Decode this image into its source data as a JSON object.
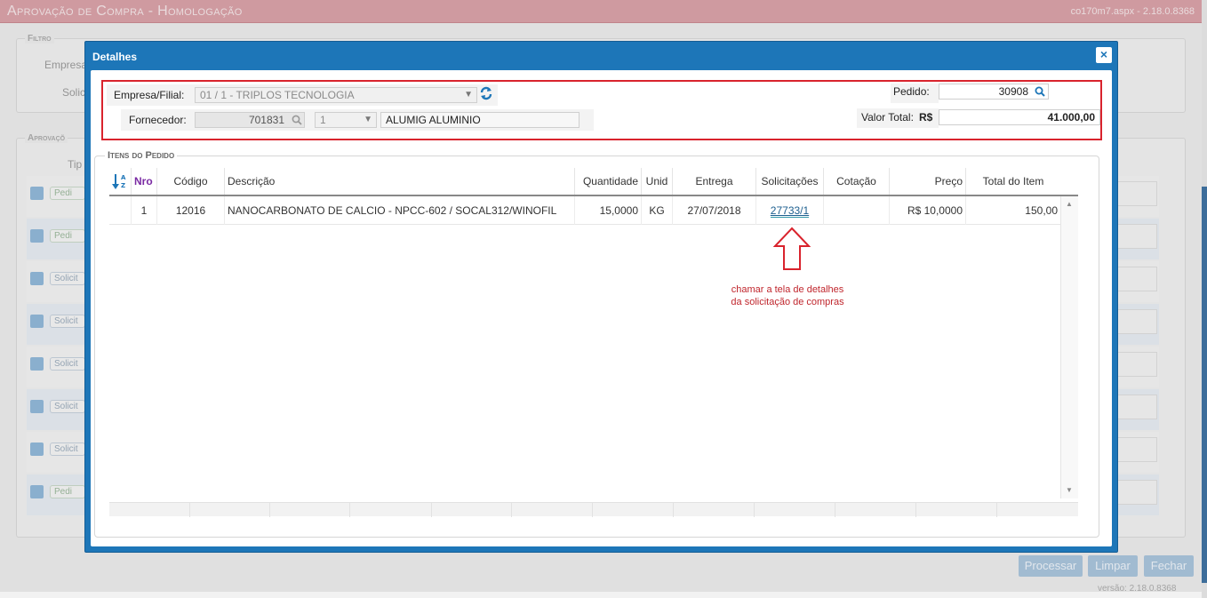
{
  "background": {
    "title": "Aprovação de Compra  - Homologação",
    "version_top": "co170m7.aspx - 2.18.0.8368",
    "filter_legend": "Filtro",
    "filter_labels": [
      "Empresa",
      "Solic"
    ],
    "approval_legend": "Aprovaçõ",
    "approval_col": "Tip",
    "rows": [
      {
        "pill": "Pedi",
        "kind": "green"
      },
      {
        "pill": "Pedi",
        "kind": "green"
      },
      {
        "pill": "Solicit",
        "kind": "blue"
      },
      {
        "pill": "Solicit",
        "kind": "blue"
      },
      {
        "pill": "Solicit",
        "kind": "blue"
      },
      {
        "pill": "Solicit",
        "kind": "blue"
      },
      {
        "pill": "Solicit",
        "kind": "blue"
      },
      {
        "pill": "Pedi",
        "kind": "green"
      }
    ],
    "buttons": {
      "processar": "Processar",
      "limpar": "Limpar",
      "fechar": "Fechar"
    },
    "version_bottom": "versão: 2.18.0.8368"
  },
  "modal": {
    "title": "Detalhes",
    "close_label": "×",
    "header": {
      "empresa_label": "Empresa/Filial:",
      "empresa_value": "01 / 1 - TRIPLOS TECNOLOGIA",
      "fornecedor_label": "Fornecedor:",
      "fornecedor_code": "701831",
      "fornecedor_seq": "1",
      "fornecedor_name": "ALUMIG ALUMINIO",
      "pedido_label": "Pedido:",
      "pedido_value": "30908",
      "valor_label": "Valor Total:",
      "currency": "R$",
      "valor_value": "41.000,00"
    },
    "items": {
      "legend": "Itens do Pedido",
      "columns": {
        "nro": "Nro",
        "codigo": "Código",
        "descricao": "Descrição",
        "quantidade": "Quantidade",
        "unid": "Unid",
        "entrega": "Entrega",
        "solicitacoes": "Solicitações",
        "cotacao": "Cotação",
        "preco": "Preço",
        "total": "Total do Item"
      },
      "rows": [
        {
          "nro": "1",
          "codigo": "12016",
          "descricao": "NANOCARBONATO DE CALCIO - NPCC-602 / SOCAL312/WINOFIL",
          "quantidade": "15,0000",
          "unid": "KG",
          "entrega": "27/07/2018",
          "solicitacoes": "27733/1",
          "cotacao": "",
          "preco": "R$ 10,0000",
          "total": "150,00"
        }
      ]
    },
    "annotation": {
      "line1": "chamar a tela de detalhes",
      "line2": "da solicitação de compras"
    }
  },
  "colors": {
    "accent": "#1d76b8",
    "highlight": "#d9232d"
  }
}
